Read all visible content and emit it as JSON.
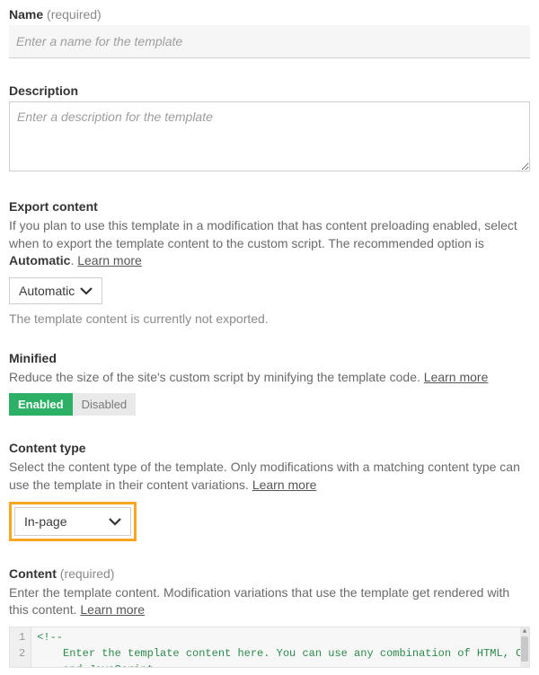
{
  "name": {
    "label": "Name",
    "required_hint": "(required)",
    "placeholder": "Enter a name for the template",
    "value": ""
  },
  "description": {
    "label": "Description",
    "placeholder": "Enter a description for the template",
    "value": ""
  },
  "export_content": {
    "label": "Export content",
    "help_pre": "If you plan to use this template in a modification that has content preloading enabled, select when to export the template content to the custom script. The recommended option is ",
    "help_bold": "Automatic",
    "help_post": ". ",
    "learn_more": "Learn more",
    "selected": "Automatic",
    "status": "The template content is currently not exported."
  },
  "minified": {
    "label": "Minified",
    "help": "Reduce the size of the site's custom script by minifying the template code. ",
    "learn_more": "Learn more",
    "enabled_label": "Enabled",
    "disabled_label": "Disabled",
    "value": "enabled"
  },
  "content_type": {
    "label": "Content type",
    "help": "Select the content type of the template. Only modifications with a matching content type can use the template in their content variations. ",
    "learn_more": "Learn more",
    "selected": "In-page"
  },
  "content": {
    "label": "Content",
    "required_hint": "(required)",
    "help": "Enter the template content. Modification variations that use the template get rendered with this content. ",
    "learn_more": "Learn more",
    "lines": {
      "n1": "1",
      "n2": "2",
      "l1": "<!--",
      "l2": "    Enter the template content here. You can use any combination of HTML, CSS,\n    and JavaScript."
    }
  }
}
